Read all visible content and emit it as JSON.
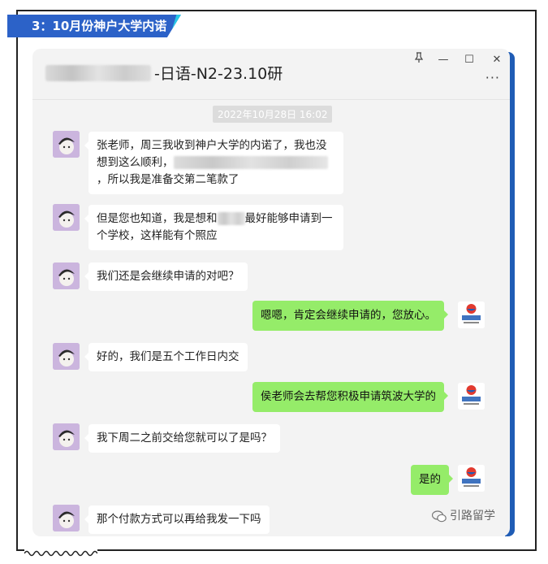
{
  "heading": "3：10月份神户大学内诺",
  "window": {
    "title_suffix": "-日语-N2-23.10研",
    "pin_icon": "pin-icon",
    "minimize": "—",
    "maximize": "☐",
    "close": "✕",
    "more": "···"
  },
  "timestamp": "2022年10月28日 16:02",
  "messages": {
    "m1_line1": "张老师，周三我收到神户大学的内诺了，我也没",
    "m1_line2": "想到这么顺利，",
    "m1_line3": "，所以我是准备交第二笔款了",
    "m2_line1a": "但是您也知道，我是想和",
    "m2_line1b": "最好能够申请到一",
    "m2_line2": "个学校，这样能有个照应",
    "m3": "我们还是会继续申请的对吧？",
    "r1": "嗯嗯，肯定会继续申请的，您放心。",
    "m4": "好的，我们是五个工作日内交",
    "r2": "侯老师会去帮您积极申请筑波大学的",
    "m5": "我下周二之前交给您就可以了是吗？",
    "r3": "是的",
    "m6": "那个付款方式可以再给我发一下吗"
  },
  "watermark": "引路留学",
  "colors": {
    "badge": "#2c62c8",
    "badge_accent": "#27c8e6",
    "sent_bubble": "#95ec69",
    "chat_bg": "#f3f3f3",
    "edge": "#1f5cb5"
  }
}
